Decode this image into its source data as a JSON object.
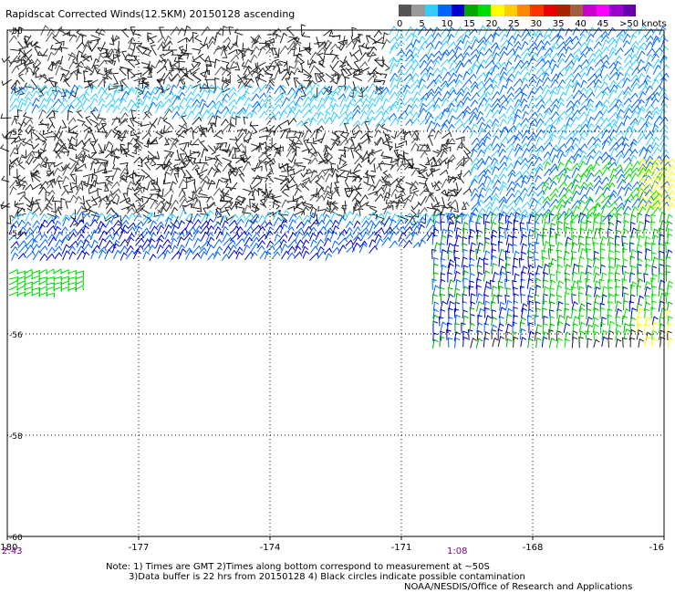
{
  "title": "Rapidscat Corrected Winds(12.5KM) 20150128 ascending",
  "legend": {
    "colors": [
      "#555555",
      "#999999",
      "#33ccff",
      "#0066ff",
      "#0000cc",
      "#00aa00",
      "#00dd00",
      "#ffff00",
      "#ffcc00",
      "#ff8800",
      "#ff3300",
      "#ee0000",
      "#aa2200",
      "#a06040",
      "#cc00cc",
      "#ff00ff",
      "#9900cc",
      "#6600aa"
    ],
    "labels": [
      "0",
      "5",
      "10",
      "15",
      "20",
      "25",
      "30",
      "35",
      "40",
      "45",
      ">50 knots"
    ]
  },
  "map": {
    "x_ticks": [
      "-180",
      "-177",
      "-174",
      "-171",
      "-168",
      "-16"
    ],
    "y_ticks": [
      "-50",
      "-52",
      "-54",
      "-56",
      "-58",
      "-60"
    ]
  },
  "times": {
    "left": "2:43",
    "center": "1:08"
  },
  "notes": {
    "line1": "Note: 1) Times are GMT 2)Times along bottom correspond to measurement at ~50S",
    "line2": "3)Data buffer is 22 hrs from 20150128 4) Black circles indicate possible contamination",
    "line3": "NOAA/NESDIS/Office of Research and Applications"
  }
}
